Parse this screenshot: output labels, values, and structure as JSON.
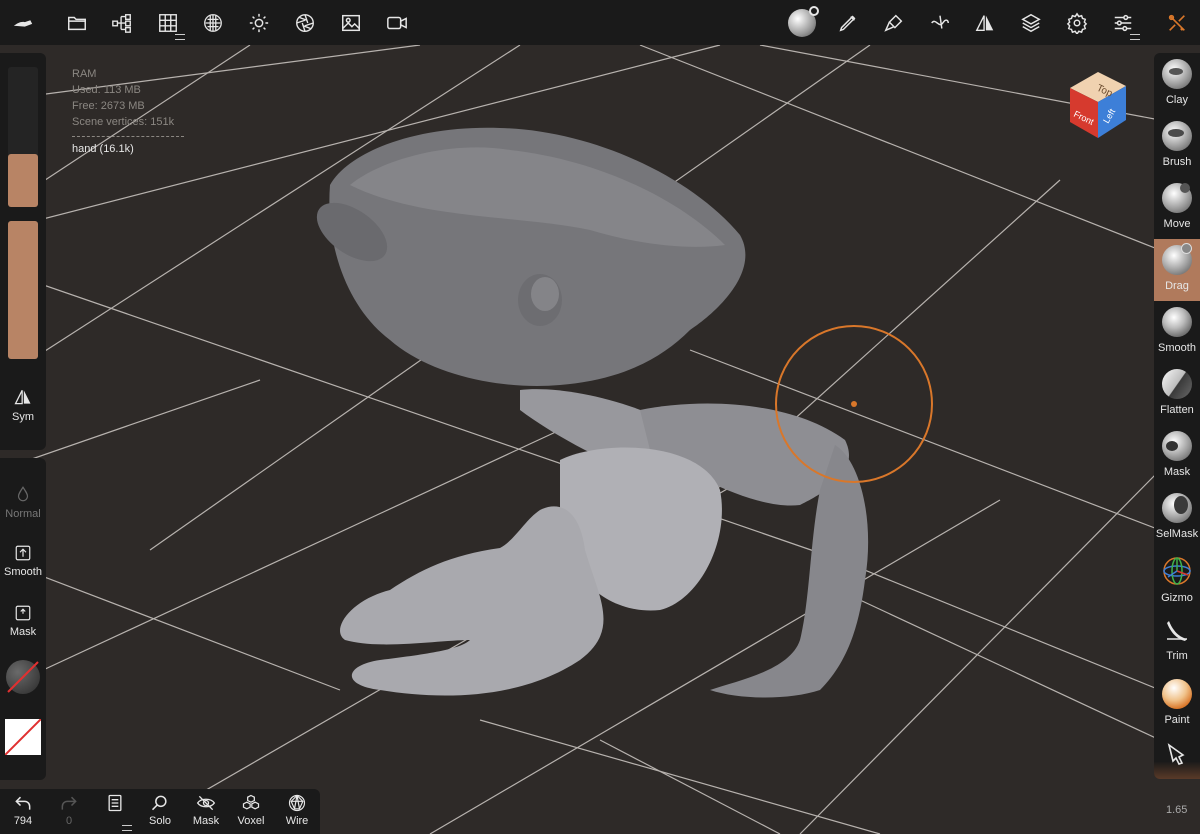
{
  "topbar": {
    "icons": [
      "nomad-logo-icon",
      "folder-icon",
      "scene-tree-icon",
      "grid-topology-icon",
      "sphere-material-icon",
      "sun-light-icon",
      "aperture-camera-icon",
      "image-icon",
      "video-icon",
      "matcap-ball-icon",
      "pen-icon",
      "brush-icon",
      "stroke-icon",
      "symmetry-icon",
      "layers-icon",
      "settings-icon",
      "sliders-icon",
      "tools-icon"
    ]
  },
  "info": {
    "ram": "RAM",
    "used": "Used: 113 MB",
    "free": "Free: 2673 MB",
    "vertices": "Scene vertices: 151k",
    "object": "hand (16.1k)"
  },
  "left": {
    "sym_label": "Sym",
    "normal_label": "Normal",
    "smooth_label": "Smooth",
    "mask_label": "Mask",
    "radius_fill": 0.38,
    "intensity_fill": 1.0
  },
  "right_tools": [
    {
      "label": "Clay",
      "active": false
    },
    {
      "label": "Brush",
      "active": false
    },
    {
      "label": "Move",
      "active": false
    },
    {
      "label": "Drag",
      "active": true
    },
    {
      "label": "Smooth",
      "active": false
    },
    {
      "label": "Flatten",
      "active": false
    },
    {
      "label": "Mask",
      "active": false
    },
    {
      "label": "SelMask",
      "active": false
    },
    {
      "label": "Gizmo",
      "active": false
    },
    {
      "label": "Trim",
      "active": false
    },
    {
      "label": "Paint",
      "active": false
    }
  ],
  "bottom": {
    "undo_count": "794",
    "redo_count": "0",
    "solo_label": "Solo",
    "mask_label": "Mask",
    "voxel_label": "Voxel",
    "wire_label": "Wire"
  },
  "viewcube": {
    "top": "Top",
    "front": "Front",
    "left": "Left"
  },
  "version": "1.65",
  "colors": {
    "accent": "#b88465",
    "active_tool": "#b07a5c",
    "brush_cursor": "#d9772a",
    "background": "#2e2a28",
    "panel": "#1a1a1a"
  }
}
